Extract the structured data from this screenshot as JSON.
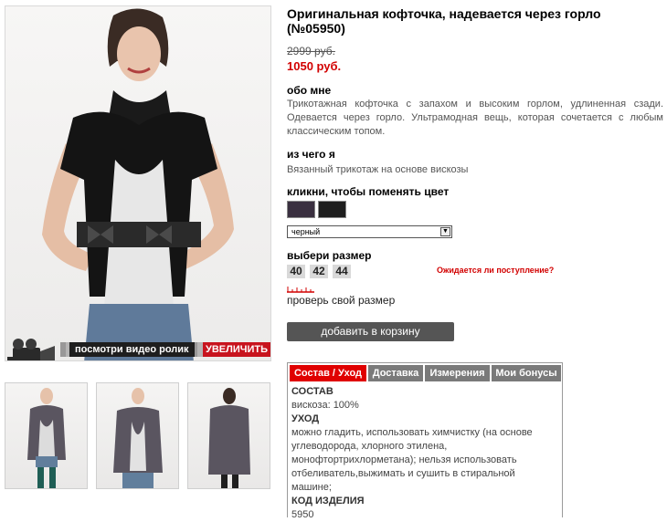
{
  "product": {
    "title": "Оригинальная кофточка, надевается через горло (№05950)",
    "old_price": "2999 руб.",
    "new_price": "1050 руб."
  },
  "about": {
    "heading": "обо мне",
    "text": "Трикотажная кофточка с запахом и высоким горлом, удлиненная сзади. Одевается через горло. Ультрамодная вещь, которая сочетается с любым классическим топом."
  },
  "material": {
    "heading": "из чего я",
    "text": "Вязанный трикотаж на основе вискозы"
  },
  "color": {
    "heading": "кликни, чтобы поменять цвет",
    "swatches": [
      "#3a3040",
      "#1e1e1e"
    ],
    "selected": "черный"
  },
  "size": {
    "heading": "выбери размер",
    "options": [
      "40",
      "42",
      "44"
    ],
    "notify_link": "Ожидается ли поступление?",
    "check_link": "проверь свой размер"
  },
  "cart_button": "добавить в корзину",
  "media": {
    "video_label": "посмотри видео ролик",
    "zoom_label": "УВЕЛИЧИТЬ"
  },
  "tabs": {
    "items": [
      "Состав / Уход",
      "Доставка",
      "Измерения",
      "Мои бонусы"
    ],
    "active": "Состав / Уход",
    "content": {
      "composition_label": "СОСТАВ",
      "composition": "вискоза: 100%",
      "care_label": "УХОД",
      "care": "можно гладить, использовать химчистку (на основе углеводорода, хлорного этилена, монофтортрихлорметана); нельзя использовать отбеливатель,выжимать и сушить в стиральной машине;",
      "code_label": "КОД ИЗДЕЛИЯ",
      "code": "5950"
    }
  },
  "colors": {
    "accent_red": "#d20000",
    "tab_active": "#e00000",
    "tab_inactive": "#7a7a7a",
    "button": "#555555"
  }
}
